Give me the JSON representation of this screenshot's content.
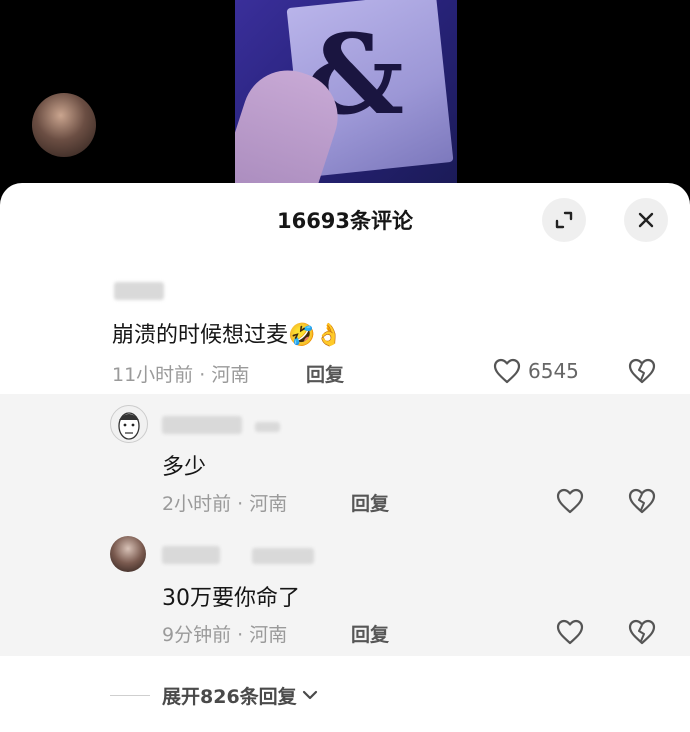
{
  "header": {
    "title": "16693条评论"
  },
  "comments": [
    {
      "text": "崩溃的时候想过麦",
      "emoji_1": "🤣",
      "emoji_2": "👌",
      "time": "11小时前",
      "dot": "·",
      "location": "河南",
      "reply_label": "回复",
      "likes": "6545"
    }
  ],
  "replies": [
    {
      "text": "多少",
      "time": "2小时前",
      "dot": "·",
      "location": "河南",
      "reply_label": "回复"
    },
    {
      "text": "30万要你命了",
      "time": "9分钟前",
      "dot": "·",
      "location": "河南",
      "reply_label": "回复"
    }
  ],
  "expand": {
    "label": "展开826条回复"
  },
  "icons": {
    "expand": "fullscreen-icon",
    "close": "close-icon",
    "like": "heart-icon",
    "dislike": "broken-heart-icon",
    "chevron": "chevron-down-icon"
  }
}
